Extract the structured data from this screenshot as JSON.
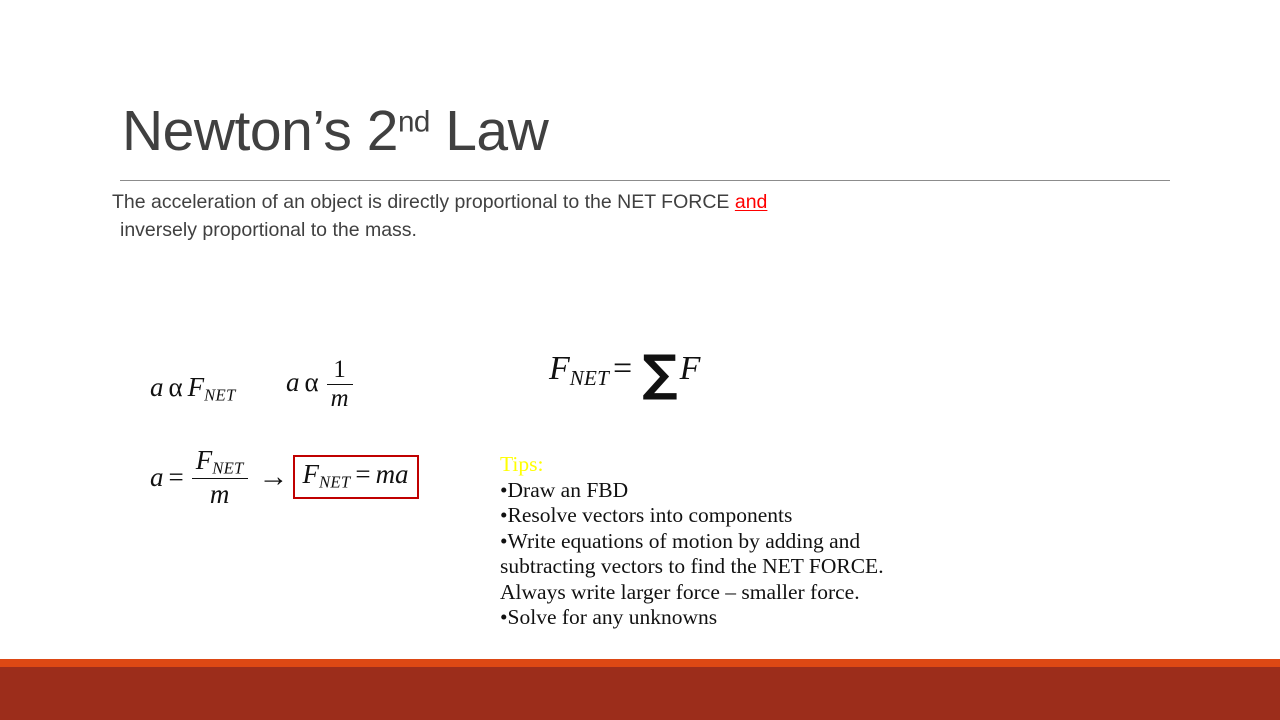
{
  "slide": {
    "title": {
      "main_before": "Newton’s 2",
      "superscript": "nd",
      "main_after": " Law"
    },
    "body": {
      "line1_a": "The acceleration of an object is directly proportional to the NET FORCE ",
      "line1_emphasis": "and",
      "line2": "inversely proportional to the mass."
    },
    "equations": {
      "proportional_force": {
        "var": "a",
        "alpha": "α",
        "quantity": "F",
        "subscript": "NET"
      },
      "proportional_mass": {
        "var": "a",
        "alpha": "α",
        "numerator": "1",
        "denominator": "m"
      },
      "derivation": {
        "lhs": "a",
        "equals": "=",
        "numerator": "F",
        "numerator_sub": "NET",
        "denominator": "m",
        "arrow": "→",
        "boxed_lhs": "F",
        "boxed_lhs_sub": "NET",
        "boxed_equals": "=",
        "boxed_rhs": "ma"
      },
      "net_force_sum": {
        "lhs": "F",
        "lhs_sub": "NET",
        "equals": "=",
        "sigma": "∑",
        "rhs": "F"
      }
    },
    "tips": {
      "heading": "Tips:",
      "items": [
        "•Draw an FBD",
        "•Resolve vectors into components",
        "•Write equations of motion by adding and",
        "subtracting vectors to find the NET FORCE.",
        "Always write larger force – smaller force.",
        "•Solve for any unknowns"
      ]
    },
    "colors": {
      "title_text": "#404040",
      "body_text": "#404040",
      "emphasis": "#ff0000",
      "tips_heading": "#ffff00",
      "box_border": "#c00000",
      "bottom_accent": "#dd4814",
      "bottom_bar": "#9c2d1b",
      "rule": "#8c8c8c"
    }
  }
}
